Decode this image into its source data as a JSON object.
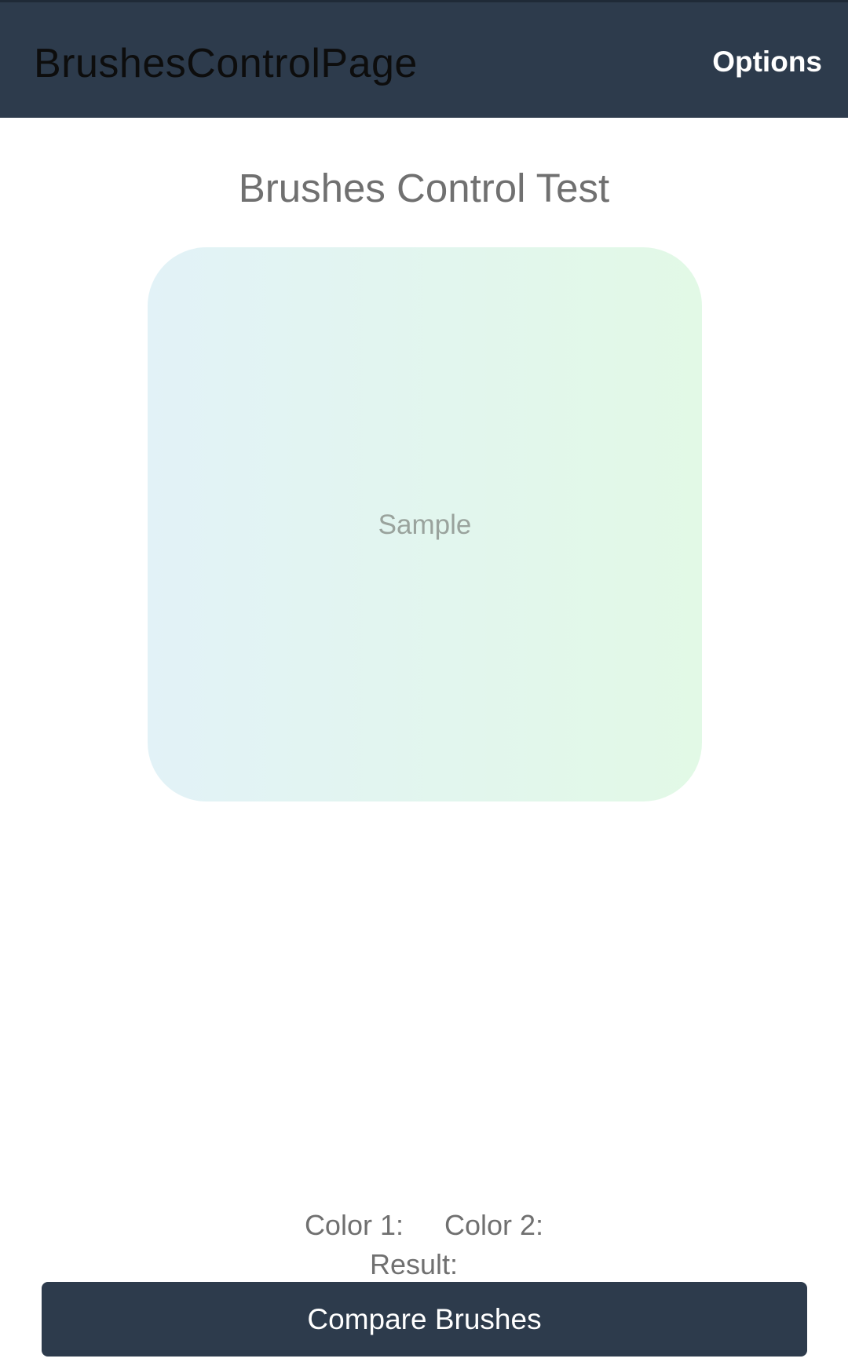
{
  "toolbar": {
    "title": "BrushesControlPage",
    "options_label": "Options"
  },
  "main": {
    "heading": "Brushes Control Test",
    "sample_label": "Sample",
    "sample_gradient": {
      "start_color": "#e2f2f7",
      "end_color": "#e2f9e6"
    },
    "color1_label": "Color 1:",
    "color2_label": "Color 2:",
    "result_label": "Result:",
    "compare_button_label": "Compare Brushes"
  },
  "colors": {
    "toolbar_background": "#2d3b4c",
    "button_background": "#2d3b4c",
    "text_secondary": "#707070"
  }
}
